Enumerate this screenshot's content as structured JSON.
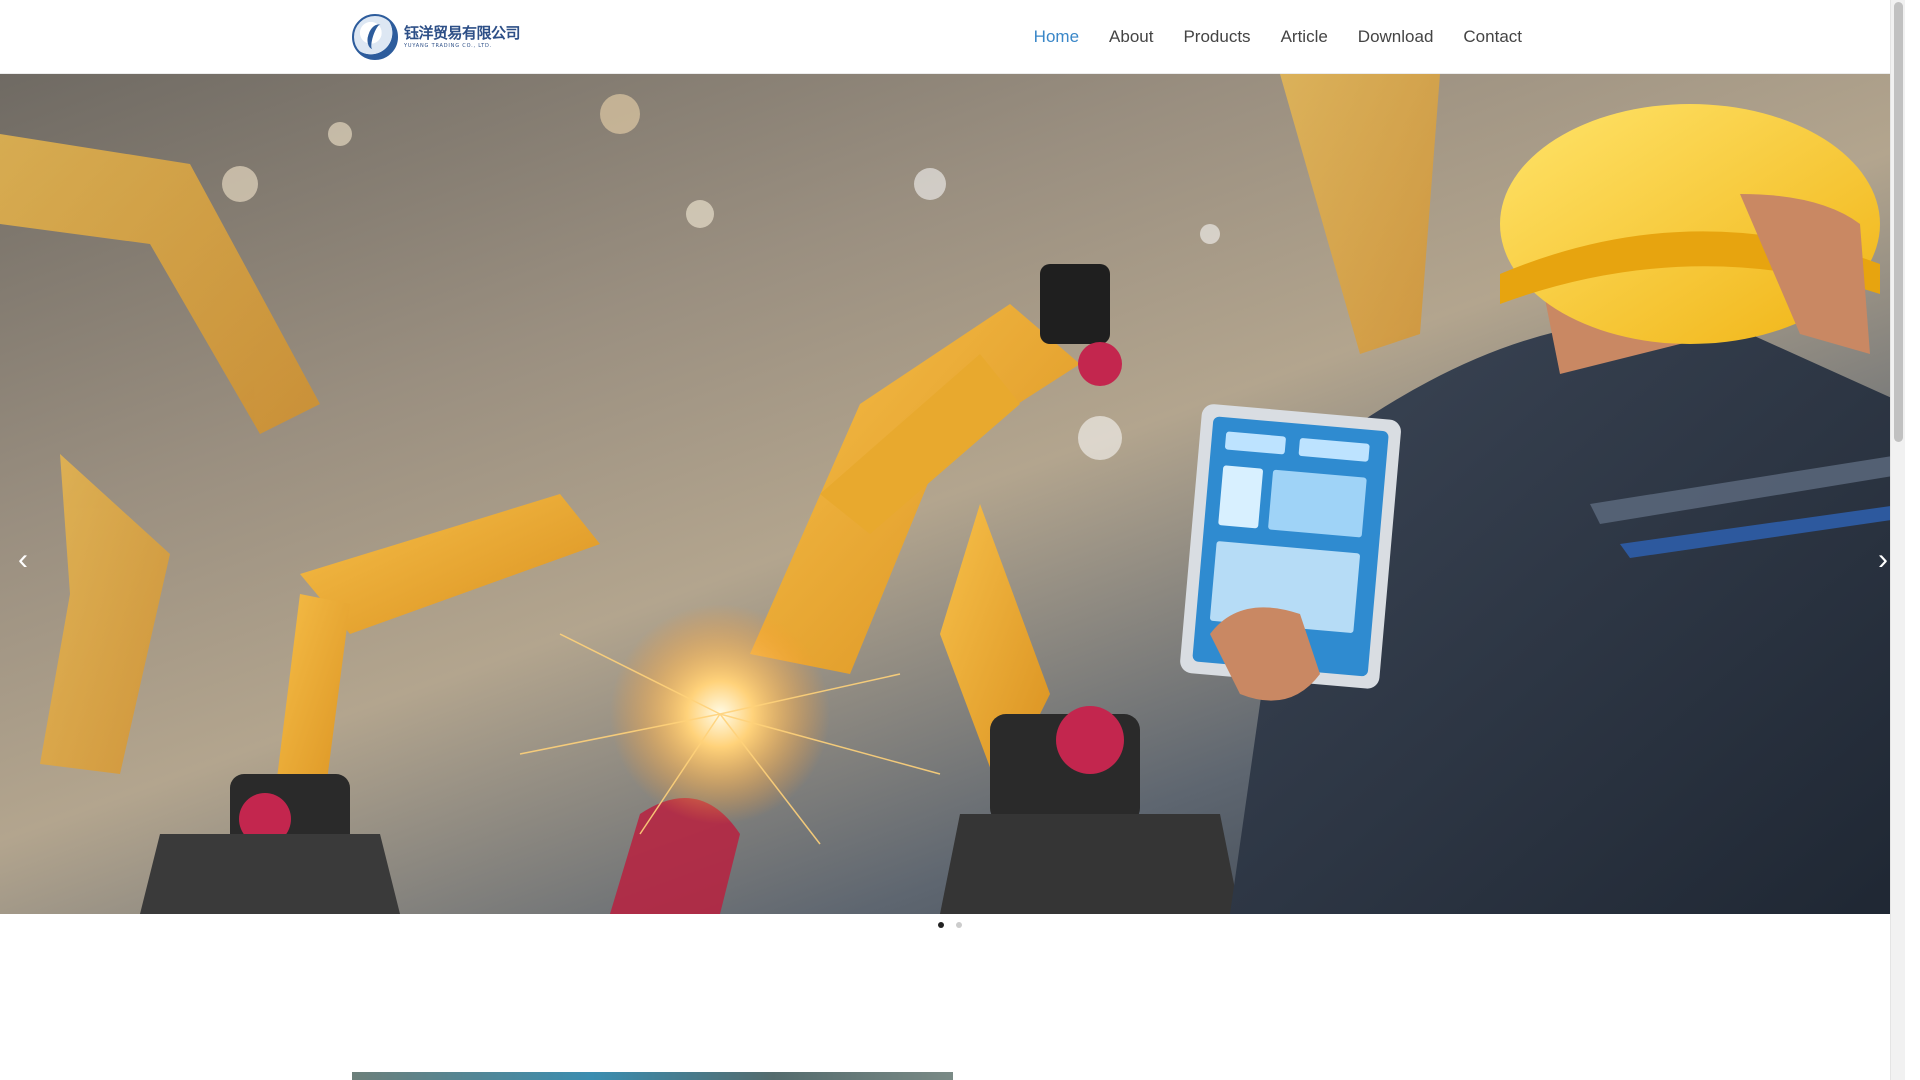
{
  "header": {
    "logo": {
      "name_cn": "钰洋贸易有限公司",
      "name_en": "YUYANG TRADING CO., LTD."
    },
    "nav": [
      {
        "label": "Home",
        "active": true
      },
      {
        "label": "About",
        "active": false
      },
      {
        "label": "Products",
        "active": false
      },
      {
        "label": "Article",
        "active": false
      },
      {
        "label": "Download",
        "active": false
      },
      {
        "label": "Contact",
        "active": false
      }
    ]
  },
  "carousel": {
    "prev_icon": "‹",
    "next_icon": "›",
    "slide_count": 2,
    "active_slide": 1
  },
  "colors": {
    "accent": "#3a87c8",
    "nav_text": "#444444",
    "logo_blue": "#2d4f87"
  }
}
